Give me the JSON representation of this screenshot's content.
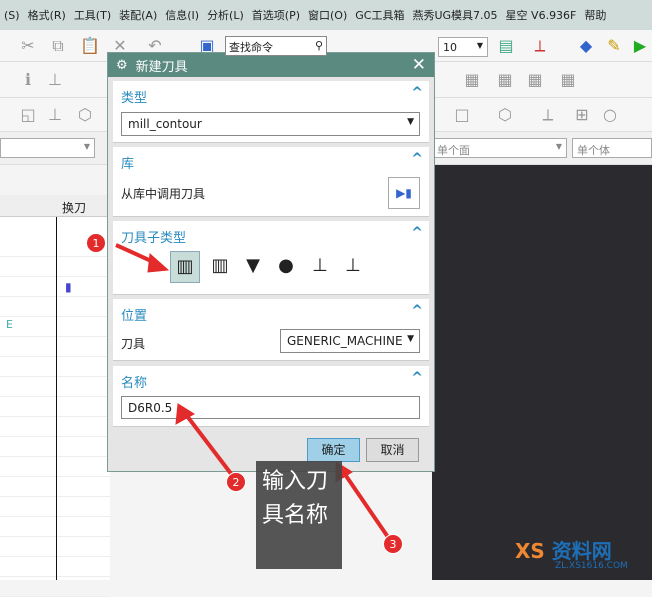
{
  "menu": [
    "(S)",
    "格式(R)",
    "工具(T)",
    "装配(A)",
    "信息(I)",
    "分析(L)",
    "首选项(P)",
    "窗口(O)",
    "GC工具箱",
    "燕秀UG模具7.05",
    "星空 V6.936F",
    "帮助"
  ],
  "toolbar": {
    "search_placeholder": "查找命令",
    "zoom_value": "10",
    "filter_face": "单个面",
    "filter_body": "单个体"
  },
  "grid": {
    "header": "换刀",
    "row_text": "E"
  },
  "dialog": {
    "title": "新建刀具",
    "type": {
      "label": "类型",
      "value": "mill_contour"
    },
    "library": {
      "label": "库",
      "text": "从库中调用刀具"
    },
    "subtype": {
      "label": "刀具子类型",
      "tools": [
        "mill",
        "chamfer-mill",
        "ball-mill",
        "spherical-mill",
        "t-cutter",
        "barrel"
      ]
    },
    "location": {
      "label": "位置",
      "field": "刀具",
      "value": "GENERIC_MACHINE"
    },
    "name": {
      "label": "名称",
      "value": "D6R0.5"
    },
    "ok": "确定",
    "cancel": "取消"
  },
  "annotations": {
    "b1": "1",
    "b2": "2",
    "b3": "3",
    "tip": "输入刀具名称",
    "color": "#e32b2b"
  },
  "watermark": {
    "title": "资料网",
    "url": "ZL.XS1616.COM"
  }
}
